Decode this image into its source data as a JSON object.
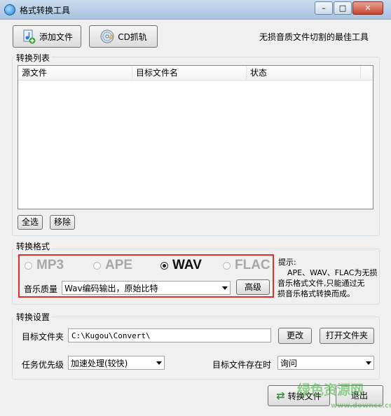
{
  "window": {
    "title": "格式转换工具"
  },
  "toolbar": {
    "add_file_label": "添加文件",
    "cd_grab_label": "CD抓轨",
    "slogan": "无损音质文件切割的最佳工具"
  },
  "convert_list": {
    "group_label": "转换列表",
    "columns": [
      "源文件",
      "目标文件名",
      "状态"
    ],
    "select_all_label": "全选",
    "remove_label": "移除"
  },
  "convert_format": {
    "group_label": "转换格式",
    "formats": [
      {
        "label": "MP3",
        "selected": false
      },
      {
        "label": "APE",
        "selected": false
      },
      {
        "label": "WAV",
        "selected": true
      },
      {
        "label": "FLAC",
        "selected": false
      }
    ],
    "quality_label": "音乐质量",
    "quality_value": "Wav编码输出，原始比特",
    "advanced_label": "高级",
    "hint_title": "提示:",
    "hint_lines": [
      "APE、WAV、FLAC为无损",
      "音乐格式文件,只能通过无",
      "损音乐格式转换而成。"
    ]
  },
  "convert_settings": {
    "group_label": "转换设置",
    "target_folder_label": "目标文件夹",
    "target_folder_value": "C:\\Kugou\\Convert\\",
    "change_label": "更改",
    "open_folder_label": "打开文件夹",
    "priority_label": "任务优先级",
    "priority_value": "加速处理(较快)",
    "exists_label": "目标文件存在时",
    "exists_value": "询问"
  },
  "actions": {
    "convert_label": "转换文件",
    "exit_label": "退出"
  },
  "watermark": {
    "text": "绿色资源网",
    "url": "www.downcc.com"
  },
  "colors": {
    "highlight": "#e0302d",
    "accent": "#1f7fd0"
  }
}
